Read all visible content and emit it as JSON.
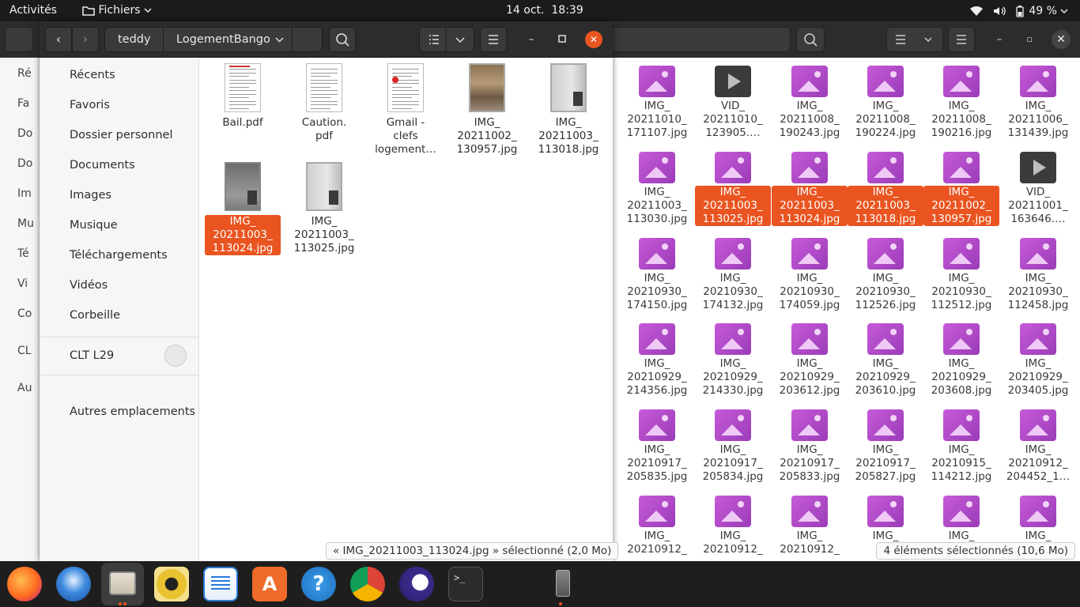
{
  "topbar": {
    "activities": "Activités",
    "app_menu": "Fichiers",
    "date": "14 oct.",
    "time": "18:39",
    "battery": "49 %"
  },
  "front_window": {
    "breadcrumb": [
      "teddy",
      "LogementBango"
    ],
    "sidebar": [
      {
        "label": "Récents",
        "icon": "clock-icon"
      },
      {
        "label": "Favoris",
        "icon": "star-icon"
      },
      {
        "label": "Dossier personnel",
        "icon": "home-icon"
      },
      {
        "label": "Documents",
        "icon": "document-icon"
      },
      {
        "label": "Images",
        "icon": "image-icon"
      },
      {
        "label": "Musique",
        "icon": "music-icon"
      },
      {
        "label": "Téléchargements",
        "icon": "download-icon"
      },
      {
        "label": "Vidéos",
        "icon": "video-icon"
      },
      {
        "label": "Corbeille",
        "icon": "trash-icon"
      }
    ],
    "device": {
      "label": "CLT L29",
      "icon": "phone-icon"
    },
    "other_locations": "Autres emplacements",
    "files": [
      {
        "name": "Bail.pdf",
        "type": "pdf",
        "selected": false
      },
      {
        "name": "Caution.\npdf",
        "type": "pdf",
        "selected": false
      },
      {
        "name": "Gmail -\nclefs\nlogement…",
        "type": "pdf-red",
        "selected": false
      },
      {
        "name": "IMG_\n20211002_\n130957.jpg",
        "type": "photo-pallet",
        "selected": false
      },
      {
        "name": "IMG_\n20211003_\n113018.jpg",
        "type": "photo-wall",
        "selected": false
      },
      {
        "name": "IMG_\n20211003_\n113024.jpg",
        "type": "photo-room",
        "selected": true
      },
      {
        "name": "IMG_\n20211003_\n113025.jpg",
        "type": "photo-wall",
        "selected": false
      }
    ],
    "status": "« IMG_20211003_113024.jpg » sélectionné  (2,0 Mo)"
  },
  "back_window": {
    "sidebar_partial": [
      "Ré",
      "Fa",
      "Do",
      "Do",
      "Im",
      "Mu",
      "Té",
      "Vi",
      "Co",
      "CL",
      "Au"
    ],
    "grid": [
      [
        {
          "l": "IMG_\n20211010_\n171107.jpg",
          "v": false,
          "s": false
        },
        {
          "l": "VID_\n20211010_\n123905.…",
          "v": true,
          "s": false
        },
        {
          "l": "IMG_\n20211008_\n190243.jpg",
          "v": false,
          "s": false
        },
        {
          "l": "IMG_\n20211008_\n190224.jpg",
          "v": false,
          "s": false
        },
        {
          "l": "IMG_\n20211008_\n190216.jpg",
          "v": false,
          "s": false
        },
        {
          "l": "IMG_\n20211006_\n131439.jpg",
          "v": false,
          "s": false
        }
      ],
      [
        {
          "l": "IMG_\n20211003_\n113030.jpg",
          "v": false,
          "s": false
        },
        {
          "l": "IMG_\n20211003_\n113025.jpg",
          "v": false,
          "s": true
        },
        {
          "l": "IMG_\n20211003_\n113024.jpg",
          "v": false,
          "s": true
        },
        {
          "l": "IMG_\n20211003_\n113018.jpg",
          "v": false,
          "s": true
        },
        {
          "l": "IMG_\n20211002_\n130957.jpg",
          "v": false,
          "s": true
        },
        {
          "l": "VID_\n20211001_\n163646.…",
          "v": true,
          "s": false
        }
      ],
      [
        {
          "l": "IMG_\n20210930_\n174150.jpg",
          "v": false,
          "s": false
        },
        {
          "l": "IMG_\n20210930_\n174132.jpg",
          "v": false,
          "s": false
        },
        {
          "l": "IMG_\n20210930_\n174059.jpg",
          "v": false,
          "s": false
        },
        {
          "l": "IMG_\n20210930_\n112526.jpg",
          "v": false,
          "s": false
        },
        {
          "l": "IMG_\n20210930_\n112512.jpg",
          "v": false,
          "s": false
        },
        {
          "l": "IMG_\n20210930_\n112458.jpg",
          "v": false,
          "s": false
        }
      ],
      [
        {
          "l": "IMG_\n20210929_\n214356.jpg",
          "v": false,
          "s": false
        },
        {
          "l": "IMG_\n20210929_\n214330.jpg",
          "v": false,
          "s": false
        },
        {
          "l": "IMG_\n20210929_\n203612.jpg",
          "v": false,
          "s": false
        },
        {
          "l": "IMG_\n20210929_\n203610.jpg",
          "v": false,
          "s": false
        },
        {
          "l": "IMG_\n20210929_\n203608.jpg",
          "v": false,
          "s": false
        },
        {
          "l": "IMG_\n20210929_\n203405.jpg",
          "v": false,
          "s": false
        }
      ],
      [
        {
          "l": "IMG_\n20210917_\n205835.jpg",
          "v": false,
          "s": false
        },
        {
          "l": "IMG_\n20210917_\n205834.jpg",
          "v": false,
          "s": false
        },
        {
          "l": "IMG_\n20210917_\n205833.jpg",
          "v": false,
          "s": false
        },
        {
          "l": "IMG_\n20210917_\n205827.jpg",
          "v": false,
          "s": false
        },
        {
          "l": "IMG_\n20210915_\n114212.jpg",
          "v": false,
          "s": false
        },
        {
          "l": "IMG_\n20210912_\n204452_1…",
          "v": false,
          "s": false
        }
      ],
      [
        {
          "l": "IMG_\n20210912_",
          "v": false,
          "s": false
        },
        {
          "l": "IMG_\n20210912_",
          "v": false,
          "s": false
        },
        {
          "l": "IMG_\n20210912_",
          "v": false,
          "s": false
        },
        {
          "l": "IMG_\n202",
          "v": false,
          "s": false
        },
        {
          "l": "IMG_",
          "v": false,
          "s": false
        },
        {
          "l": "IMG_",
          "v": false,
          "s": false
        }
      ]
    ],
    "status": "4 éléments sélectionnés  (10,6 Mo)"
  },
  "dock": [
    {
      "name": "firefox",
      "running": false
    },
    {
      "name": "thunderbird",
      "running": false
    },
    {
      "name": "files",
      "running": true
    },
    {
      "name": "rhythmbox",
      "running": false
    },
    {
      "name": "libreoffice-writer",
      "running": false
    },
    {
      "name": "software-center",
      "running": false
    },
    {
      "name": "help",
      "running": false
    },
    {
      "name": "chrome",
      "running": false
    },
    {
      "name": "eclipse",
      "running": false
    },
    {
      "name": "terminal",
      "running": false
    },
    {
      "name": "vscode",
      "running": false
    },
    {
      "name": "phone",
      "running": true
    },
    {
      "name": "show-apps",
      "running": false
    }
  ],
  "colors": {
    "accent": "#e95420",
    "header": "#2c2c2c",
    "image_icon": "#c65ad8"
  }
}
